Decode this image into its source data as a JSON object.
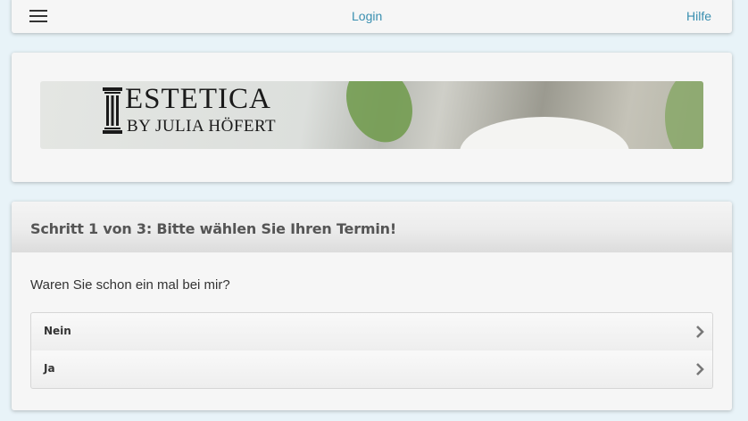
{
  "topbar": {
    "menu_icon": "hamburger-menu-icon",
    "login_label": "Login",
    "help_label": "Hilfe",
    "link_color": "#3a8fb0"
  },
  "banner": {
    "logo_title": "ESTETICA",
    "logo_subtitle": "BY JULIA HÖFERT",
    "logo_icon": "pillar-icon"
  },
  "step": {
    "title": "Schritt 1 von 3: Bitte wählen Sie Ihren Termin!",
    "question": "Waren Sie schon ein mal bei mir?",
    "options": [
      {
        "label": "Nein",
        "icon": "chevron-right-icon"
      },
      {
        "label": "Ja",
        "icon": "chevron-right-icon"
      }
    ]
  }
}
